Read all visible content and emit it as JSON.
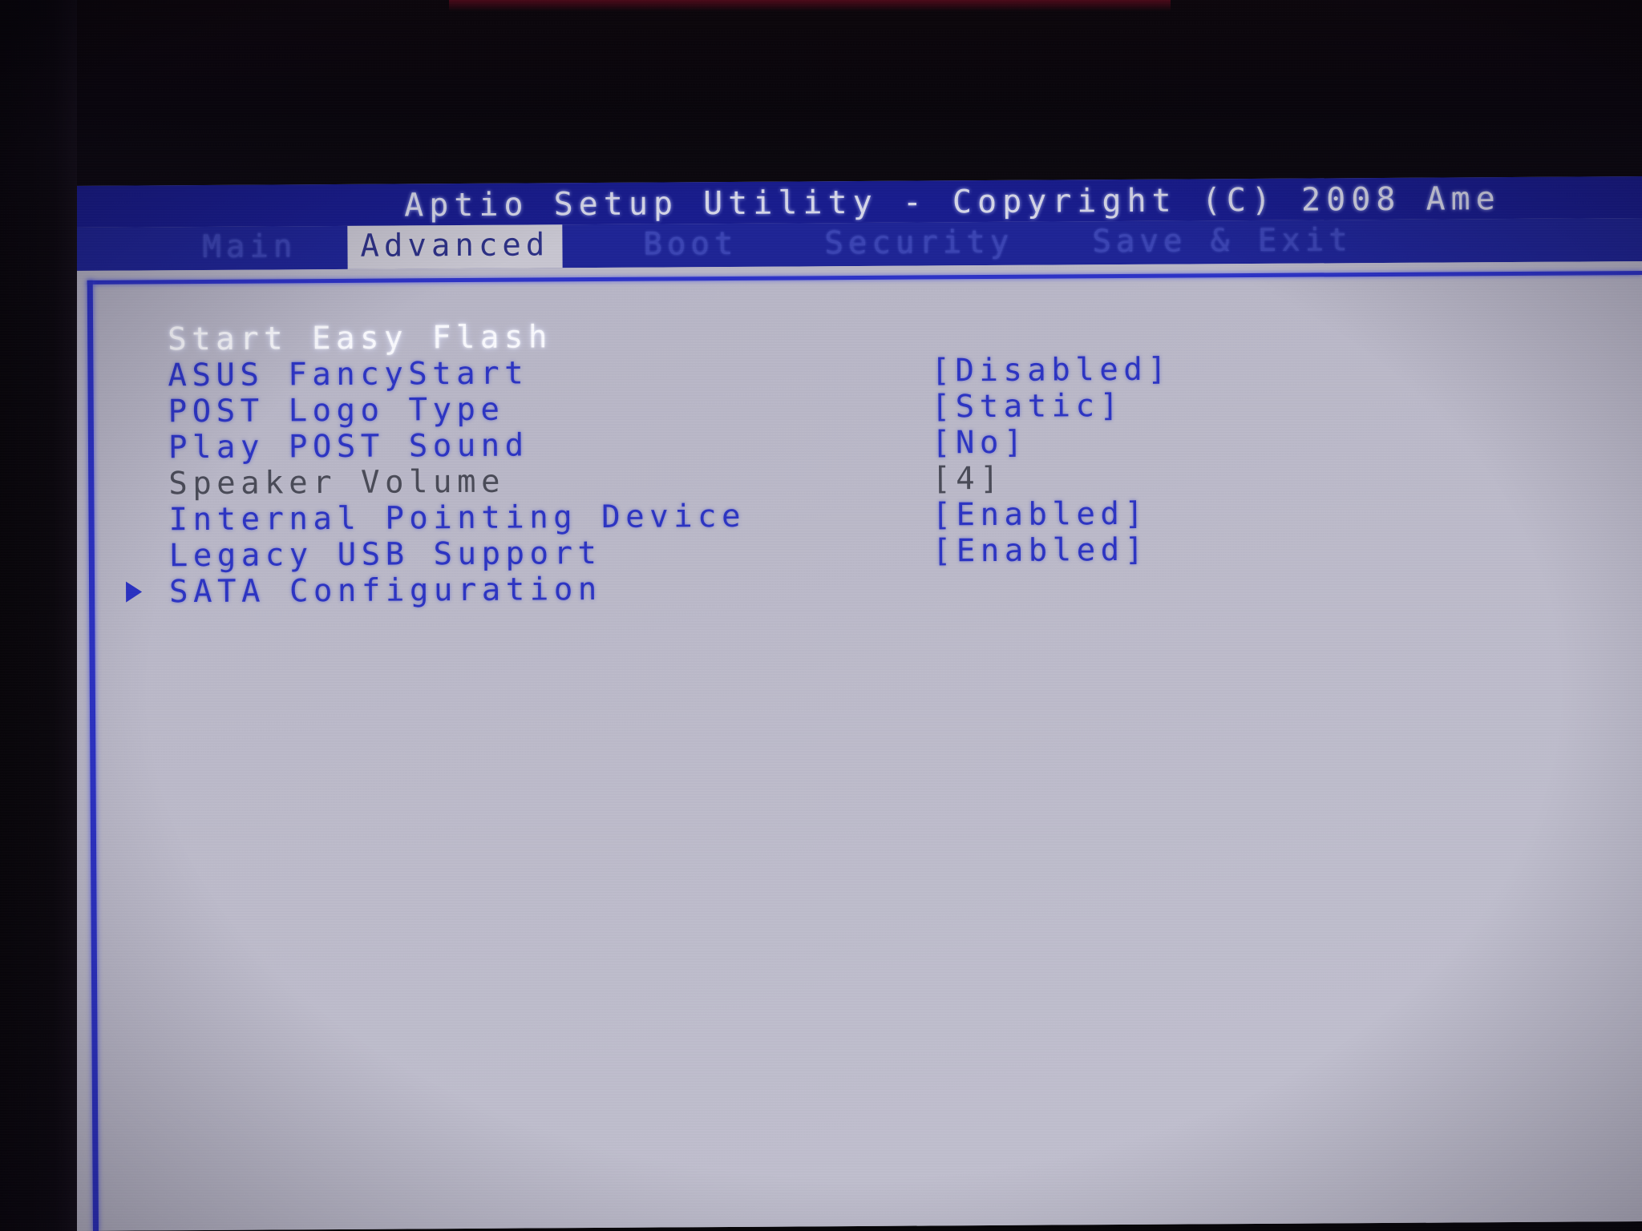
{
  "window": {
    "title": "Aptio Setup Utility - Copyright (C) 2008 Ame"
  },
  "menubar": {
    "tabs": [
      {
        "label": "Main",
        "active": false
      },
      {
        "label": "Advanced",
        "active": true
      },
      {
        "label": "Boot",
        "active": false
      },
      {
        "label": "Security",
        "active": false
      },
      {
        "label": "Save & Exit",
        "active": false
      }
    ]
  },
  "settings": {
    "rows": [
      {
        "arrow": "",
        "label": "Start Easy Flash",
        "value": "",
        "state": "selected"
      },
      {
        "arrow": "",
        "label": "ASUS FancyStart",
        "value": "[Disabled]",
        "state": "normal"
      },
      {
        "arrow": "",
        "label": "POST Logo Type",
        "value": "[Static]",
        "state": "normal"
      },
      {
        "arrow": "",
        "label": "Play POST Sound",
        "value": "[No]",
        "state": "normal"
      },
      {
        "arrow": "",
        "label": "Speaker Volume",
        "value": "[4]",
        "state": "disabled"
      },
      {
        "arrow": "",
        "label": "Internal Pointing Device",
        "value": "[Enabled]",
        "state": "normal"
      },
      {
        "arrow": "",
        "label": "Legacy USB Support",
        "value": "[Enabled]",
        "state": "normal"
      },
      {
        "arrow": "submenu-arrow-icon",
        "label": "SATA Configuration",
        "value": "",
        "state": "normal"
      }
    ]
  },
  "colors": {
    "header_blue": "#171b8e",
    "menubar_blue": "#1d2396",
    "panel_gray": "#bdbbcb",
    "text_blue": "#2b33c4",
    "text_selected": "#fbfbff",
    "text_disabled": "#494a57",
    "active_tab_bg": "#c9c7d2"
  }
}
